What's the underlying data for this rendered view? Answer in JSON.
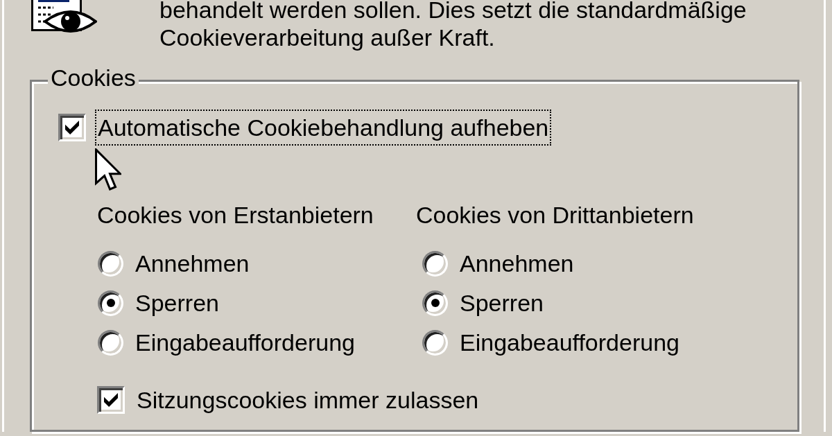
{
  "description": "behandelt werden sollen. Dies setzt die standardmäßige Cookieverarbeitung außer Kraft.",
  "cookies_group": {
    "title": "Cookies",
    "override": {
      "label": "Automatische Cookiebehandlung aufheben",
      "checked": true,
      "focused": true
    },
    "columns": [
      {
        "heading": "Cookies von Erstanbietern",
        "options": [
          {
            "label": "Annehmen",
            "selected": false
          },
          {
            "label": "Sperren",
            "selected": true
          },
          {
            "label": "Eingabeaufforderung",
            "selected": false
          }
        ]
      },
      {
        "heading": "Cookies von Drittanbietern",
        "options": [
          {
            "label": "Annehmen",
            "selected": false
          },
          {
            "label": "Sperren",
            "selected": true
          },
          {
            "label": "Eingabeaufforderung",
            "selected": false
          }
        ]
      }
    ],
    "session_cookies": {
      "label": "Sitzungscookies immer zulassen",
      "checked": true
    }
  }
}
